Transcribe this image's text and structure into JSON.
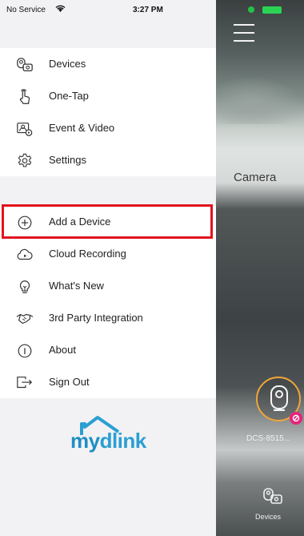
{
  "status_bar": {
    "carrier": "No Service",
    "time": "3:27 PM"
  },
  "background": {
    "camera_label": "Camera",
    "device_label": "DCS-8515...",
    "tab_devices_label": "Devices"
  },
  "menu": {
    "top": [
      {
        "label": "Devices",
        "icon": "devices-icon"
      },
      {
        "label": "One-Tap",
        "icon": "one-tap-hand-icon"
      },
      {
        "label": "Event & Video",
        "icon": "event-video-icon"
      },
      {
        "label": "Settings",
        "icon": "settings-gear-icon"
      }
    ],
    "bottom": [
      {
        "label": "Add a Device",
        "icon": "plus-circle-icon"
      },
      {
        "label": "Cloud Recording",
        "icon": "cloud-recording-icon"
      },
      {
        "label": "What's New",
        "icon": "lightbulb-icon"
      },
      {
        "label": "3rd Party Integration",
        "icon": "handshake-icon"
      },
      {
        "label": "About",
        "icon": "info-icon"
      },
      {
        "label": "Sign Out",
        "icon": "sign-out-icon"
      }
    ]
  },
  "brand": {
    "logo_prefix": "my",
    "logo_suffix": "dlink"
  },
  "colors": {
    "highlight": "#e1141e",
    "brand_blue": "#2b9fd3",
    "camera_ring": "#f0a53a",
    "alert_badge": "#e6237a"
  }
}
